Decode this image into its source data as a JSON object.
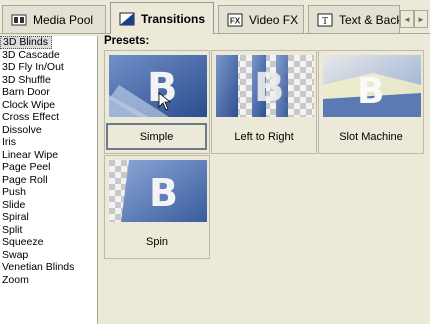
{
  "tabs": [
    {
      "label": "Media Pool",
      "icon": "media-pool-icon",
      "active": false
    },
    {
      "label": "Transitions",
      "icon": "transitions-icon",
      "active": true
    },
    {
      "label": "Video FX",
      "icon": "video-fx-icon",
      "active": false
    },
    {
      "label": "Text & Backgrounds",
      "icon": "text-icon",
      "active": false
    }
  ],
  "tab_scroll": {
    "left": "◄",
    "right": "►"
  },
  "transitions_list": [
    "3D Blinds",
    "3D Cascade",
    "3D Fly In/Out",
    "3D Shuffle",
    "Barn Door",
    "Clock Wipe",
    "Cross Effect",
    "Dissolve",
    "Iris",
    "Linear Wipe",
    "Page Peel",
    "Page Roll",
    "Push",
    "Slide",
    "Spiral",
    "Split",
    "Squeeze",
    "Swap",
    "Venetian Blinds",
    "Zoom"
  ],
  "selected_transition": "3D Blinds",
  "presets_label": "Presets:",
  "presets": [
    {
      "label": "Simple",
      "selected": true
    },
    {
      "label": "Left to Right",
      "selected": false
    },
    {
      "label": "Slot Machine",
      "selected": false
    },
    {
      "label": "Spin",
      "selected": false
    }
  ],
  "tab_text_visible": "Text & Backg"
}
